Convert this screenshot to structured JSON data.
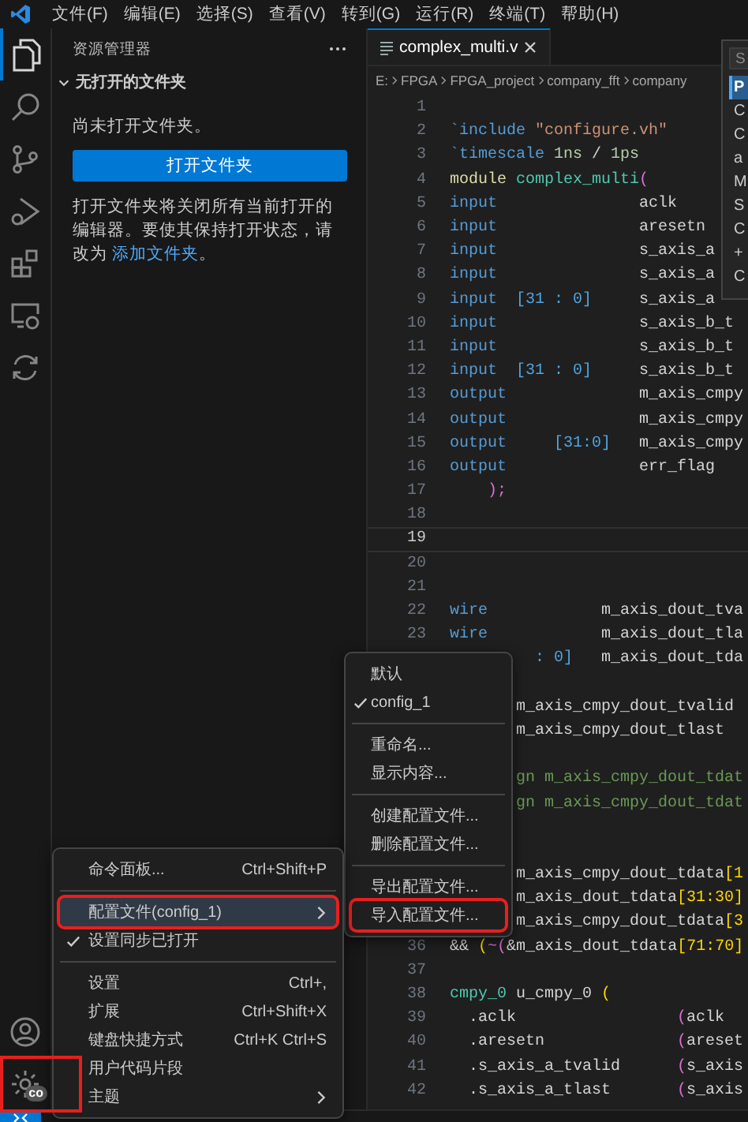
{
  "menubar": {
    "items": [
      "文件(F)",
      "编辑(E)",
      "选择(S)",
      "查看(V)",
      "转到(G)",
      "运行(R)",
      "终端(T)",
      "帮助(H)"
    ]
  },
  "activity_bar": {
    "items": [
      {
        "kind": "files",
        "selected": true
      },
      {
        "kind": "search",
        "selected": false
      },
      {
        "kind": "scm",
        "selected": false
      },
      {
        "kind": "run",
        "selected": false
      },
      {
        "kind": "extensions",
        "selected": false
      },
      {
        "kind": "remote",
        "selected": false
      },
      {
        "kind": "sync",
        "selected": false
      }
    ],
    "bottom": [
      {
        "kind": "account",
        "outlined": false
      },
      {
        "kind": "gear",
        "badge": "co",
        "outlined": true
      }
    ]
  },
  "sidebar": {
    "title": "资源管理器",
    "section": {
      "title": "无打开的文件夹",
      "expanded": true
    },
    "message": "尚未打开文件夹。",
    "button": "打开文件夹",
    "note": "打开文件夹将关闭所有当前打开的编辑器。要使其保持打开状态，请改为 ",
    "note_link": "添加文件夹",
    "note_end": "。"
  },
  "editor": {
    "tabs": [
      {
        "label": "complex_multi.v",
        "selected": true
      }
    ],
    "breadcrumb": [
      "E:",
      "FPGA",
      "FPGA_project",
      "company_fft",
      "company"
    ],
    "lines": [
      {
        "number": "1",
        "current": false
      },
      {
        "number": "2",
        "current": false,
        "tokens": [
          {
            "text": "`include",
            "kind": "kw"
          },
          {
            "text": " \"configure.vh\"",
            "kind": "str"
          }
        ]
      },
      {
        "number": "3",
        "current": false,
        "tokens": [
          {
            "text": "`timescale",
            "kind": "kw"
          },
          {
            "text": " 1ns",
            "kind": "num"
          },
          {
            "text": " /",
            "kind": "id"
          },
          {
            "text": " 1ps",
            "kind": "num"
          }
        ]
      },
      {
        "number": "4",
        "current": false,
        "tokens": [
          {
            "text": "module",
            "kind": "mod"
          },
          {
            "text": " complex_multi",
            "kind": "type"
          },
          {
            "text": "(",
            "kind": "p2"
          }
        ]
      },
      {
        "number": "5",
        "current": false,
        "tokens": [
          {
            "text": "input",
            "kind": "kw"
          },
          {
            "text": "               aclk",
            "kind": "id"
          }
        ]
      },
      {
        "number": "6",
        "current": false,
        "tokens": [
          {
            "text": "input",
            "kind": "kw"
          },
          {
            "text": "               aresetn",
            "kind": "id"
          }
        ]
      },
      {
        "number": "7",
        "current": false,
        "tokens": [
          {
            "text": "input",
            "kind": "kw"
          },
          {
            "text": "               s_axis_a",
            "kind": "id"
          }
        ]
      },
      {
        "number": "8",
        "current": false,
        "tokens": [
          {
            "text": "input",
            "kind": "kw"
          },
          {
            "text": "               s_axis_a",
            "kind": "id"
          }
        ]
      },
      {
        "number": "9",
        "current": false,
        "tokens": [
          {
            "text": "input",
            "kind": "kw"
          },
          {
            "text": "  [31 : 0]",
            "kind": "range"
          },
          {
            "text": "     s_axis_a",
            "kind": "id"
          }
        ]
      },
      {
        "number": "10",
        "current": false,
        "tokens": [
          {
            "text": "input",
            "kind": "kw"
          },
          {
            "text": "               s_axis_b_t",
            "kind": "id"
          }
        ]
      },
      {
        "number": "11",
        "current": false,
        "tokens": [
          {
            "text": "input",
            "kind": "kw"
          },
          {
            "text": "               s_axis_b_t",
            "kind": "id"
          }
        ]
      },
      {
        "number": "12",
        "current": false,
        "tokens": [
          {
            "text": "input",
            "kind": "kw"
          },
          {
            "text": "  [31 : 0]",
            "kind": "range"
          },
          {
            "text": "     s_axis_b_t",
            "kind": "id"
          }
        ]
      },
      {
        "number": "13",
        "current": false,
        "tokens": [
          {
            "text": "output",
            "kind": "kw"
          },
          {
            "text": "              m_axis_cmpy",
            "kind": "id"
          }
        ]
      },
      {
        "number": "14",
        "current": false,
        "tokens": [
          {
            "text": "output",
            "kind": "kw"
          },
          {
            "text": "              m_axis_cmpy",
            "kind": "id"
          }
        ]
      },
      {
        "number": "15",
        "current": false,
        "tokens": [
          {
            "text": "output",
            "kind": "kw"
          },
          {
            "text": "     [31:0]",
            "kind": "range"
          },
          {
            "text": "   m_axis_cmpy",
            "kind": "id"
          }
        ]
      },
      {
        "number": "16",
        "current": false,
        "tokens": [
          {
            "text": "output",
            "kind": "kw"
          },
          {
            "text": "              err_flag",
            "kind": "id"
          }
        ]
      },
      {
        "number": "17",
        "current": false,
        "tokens": [
          {
            "text": "    );",
            "kind": "p2"
          }
        ]
      },
      {
        "number": "18",
        "current": false
      },
      {
        "number": "19",
        "current": true
      },
      {
        "number": "20",
        "current": false
      },
      {
        "number": "21",
        "current": false
      },
      {
        "number": "22",
        "current": false,
        "tokens": [
          {
            "text": "wire",
            "kind": "kw"
          },
          {
            "text": "            m_axis_dout_tva",
            "kind": "id"
          }
        ]
      },
      {
        "number": "23",
        "current": false,
        "tokens": [
          {
            "text": "wire",
            "kind": "kw"
          },
          {
            "text": "            m_axis_dout_tla",
            "kind": "id"
          }
        ]
      },
      {
        "current": false,
        "tokens": [
          {
            "text": "         : 0]",
            "kind": "range"
          },
          {
            "text": "   m_axis_dout_tda",
            "kind": "id"
          }
        ]
      },
      {
        "current": false
      },
      {
        "current": false,
        "tokens": [
          {
            "text": "       m_axis_cmpy_dout_tvalid",
            "kind": "id"
          }
        ]
      },
      {
        "current": false,
        "tokens": [
          {
            "text": "       m_axis_cmpy_dout_tlast",
            "kind": "id"
          }
        ]
      },
      {
        "current": false
      },
      {
        "current": false,
        "tokens": [
          {
            "text": "       gn m_axis_cmpy_dout_tdat",
            "kind": "cm"
          }
        ]
      },
      {
        "current": false,
        "tokens": [
          {
            "text": "       gn m_axis_cmpy_dout_tdat",
            "kind": "cm"
          }
        ]
      },
      {
        "current": false
      },
      {
        "current": false
      },
      {
        "current": false,
        "tokens": [
          {
            "text": "       m_axis_cmpy_dout_tdata",
            "kind": "id"
          },
          {
            "text": "[1",
            "kind": "br"
          }
        ]
      },
      {
        "current": false,
        "tokens": [
          {
            "text": "       m_axis_dout_tdata",
            "kind": "id"
          },
          {
            "text": "[31:30]",
            "kind": "br"
          }
        ]
      },
      {
        "current": false,
        "tokens": [
          {
            "text": "       m_axis_cmpy_dout_tdata",
            "kind": "id"
          },
          {
            "text": "[3",
            "kind": "br"
          }
        ]
      },
      {
        "number": "36",
        "current": false,
        "tokens": [
          {
            "text": "&&",
            "kind": "id"
          },
          {
            "text": " (",
            "kind": "br"
          },
          {
            "text": "~(",
            "kind": "p2"
          },
          {
            "text": "&m_axis_dout_tdata",
            "kind": "id"
          },
          {
            "text": "[71:70]",
            "kind": "br"
          }
        ]
      },
      {
        "number": "37",
        "current": false
      },
      {
        "number": "38",
        "current": false,
        "tokens": [
          {
            "text": "cmpy_0",
            "kind": "type"
          },
          {
            "text": " u_cmpy_0",
            "kind": "id"
          },
          {
            "text": " (",
            "kind": "br"
          }
        ]
      },
      {
        "number": "39",
        "current": false,
        "tokens": [
          {
            "text": "  .aclk",
            "kind": "id"
          },
          {
            "text": "                 (",
            "kind": "p2"
          },
          {
            "text": "aclk",
            "kind": "id"
          }
        ]
      },
      {
        "number": "40",
        "current": false,
        "tokens": [
          {
            "text": "  .aresetn",
            "kind": "id"
          },
          {
            "text": "              (",
            "kind": "p2"
          },
          {
            "text": "areset",
            "kind": "id"
          }
        ]
      },
      {
        "number": "41",
        "current": false,
        "tokens": [
          {
            "text": "  .s_axis_a_tvalid",
            "kind": "id"
          },
          {
            "text": "      (",
            "kind": "p2"
          },
          {
            "text": "s_axis",
            "kind": "id"
          }
        ]
      },
      {
        "number": "42",
        "current": false,
        "tokens": [
          {
            "text": "  .s_axis_a_tlast",
            "kind": "id"
          },
          {
            "text": "       (",
            "kind": "p2"
          },
          {
            "text": "s_axis",
            "kind": "id"
          }
        ]
      }
    ]
  },
  "quick_pick": {
    "placeholder": "S",
    "items": [
      {
        "label": "P",
        "kind": "focused"
      },
      {
        "label": "C",
        "kind": "option"
      },
      {
        "label": "C",
        "kind": "option"
      },
      {
        "label": "a",
        "kind": "option"
      },
      {
        "label": "M",
        "kind": "option"
      },
      {
        "label": "S",
        "kind": "option"
      },
      {
        "label": "C",
        "kind": "option"
      },
      {
        "label": "+",
        "kind": "option"
      },
      {
        "label": "C",
        "kind": "option"
      }
    ]
  },
  "context_menu": {
    "items": [
      {
        "kind": "item",
        "label": "命令面板...",
        "shortcut": "Ctrl+Shift+P",
        "checked": false,
        "highlighted": false,
        "outlined": false
      },
      {
        "kind": "separator"
      },
      {
        "kind": "submenu",
        "label": "配置文件(config_1)",
        "checked": false,
        "highlighted": true,
        "outlined": true
      },
      {
        "kind": "item",
        "label": "设置同步已打开",
        "checked": true,
        "highlighted": false,
        "outlined": false
      },
      {
        "kind": "separator"
      },
      {
        "kind": "item",
        "label": "设置",
        "shortcut": "Ctrl+,",
        "checked": false,
        "highlighted": false,
        "outlined": false
      },
      {
        "kind": "item",
        "label": "扩展",
        "shortcut": "Ctrl+Shift+X",
        "checked": false,
        "highlighted": false,
        "outlined": false
      },
      {
        "kind": "item",
        "label": "键盘快捷方式",
        "shortcut": "Ctrl+K Ctrl+S",
        "checked": false,
        "highlighted": false,
        "outlined": false
      },
      {
        "kind": "item",
        "label": "用户代码片段",
        "checked": false,
        "highlighted": false,
        "outlined": false
      },
      {
        "kind": "submenu",
        "label": "主题",
        "checked": false,
        "highlighted": false,
        "outlined": false
      }
    ]
  },
  "submenu": {
    "items": [
      {
        "kind": "item",
        "label": "默认",
        "checked": false,
        "highlighted": false,
        "outlined": false
      },
      {
        "kind": "item",
        "label": "config_1",
        "checked": true,
        "highlighted": false,
        "outlined": false
      },
      {
        "kind": "separator"
      },
      {
        "kind": "item",
        "label": "重命名...",
        "checked": false,
        "highlighted": false,
        "outlined": false
      },
      {
        "kind": "item",
        "label": "显示内容...",
        "checked": false,
        "highlighted": false,
        "outlined": false
      },
      {
        "kind": "separator"
      },
      {
        "kind": "item",
        "label": "创建配置文件...",
        "checked": false,
        "highlighted": false,
        "outlined": false
      },
      {
        "kind": "item",
        "label": "删除配置文件...",
        "checked": false,
        "highlighted": false,
        "outlined": false
      },
      {
        "kind": "separator"
      },
      {
        "kind": "item",
        "label": "导出配置文件...",
        "checked": false,
        "highlighted": false,
        "outlined": false
      },
      {
        "kind": "item",
        "label": "导入配置文件...",
        "checked": false,
        "highlighted": false,
        "outlined": true
      }
    ]
  }
}
